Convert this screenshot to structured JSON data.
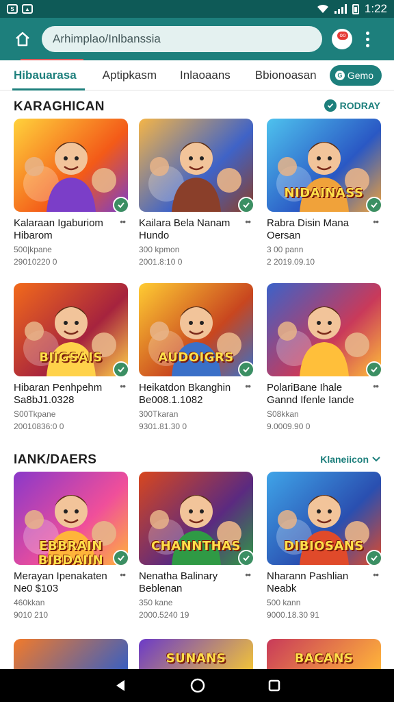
{
  "status_bar": {
    "time": "1:22"
  },
  "app_bar": {
    "url": "Arhimplao/Inlbanssia"
  },
  "tabs": [
    {
      "label": "Hibauarasa",
      "active": true
    },
    {
      "label": "Aptipkasm",
      "active": false
    },
    {
      "label": "Inlaoaans",
      "active": false
    },
    {
      "label": "Bbionoasan",
      "active": false
    }
  ],
  "games_chip": {
    "label": "Gemo"
  },
  "sections": [
    {
      "title": "KARAGHICAN",
      "action": "RODRAY",
      "cards": [
        {
          "title": "Kalaraan Igaburiom Hibarom",
          "meta1": "500|kpane",
          "meta2": "29010220 0",
          "thumb_text": "",
          "palette": [
            "#ffd23c",
            "#f35a18",
            "#7b3ec8"
          ]
        },
        {
          "title": "Kailara Bela Nanam Hundo",
          "meta1": "300 kpmon",
          "meta2": "2001.8:10 0",
          "thumb_text": "",
          "palette": [
            "#f5b547",
            "#3f63c7",
            "#8a3f2a"
          ]
        },
        {
          "title": "Rabra Disin Mana Oersan",
          "meta1": "3 00 pann",
          "meta2": "2 2019.09.10",
          "thumb_text": "NIDAINASS",
          "palette": [
            "#4ec2ee",
            "#2a58c4",
            "#f0a23a"
          ]
        },
        {
          "title": "Hibaran Penhpehm Sa8bJ1.0328",
          "meta1": "S00Tkpane",
          "meta2": "20010836:0 0",
          "thumb_text": "BIIGSAIS",
          "palette": [
            "#f26a1b",
            "#a6233e",
            "#ffd24a"
          ]
        },
        {
          "title": "Heikatdon Bkanghin Be008.1.1082",
          "meta1": "300Tkaran",
          "meta2": "9301.81.30 0",
          "thumb_text": "AUDOIGRS",
          "palette": [
            "#ffcc33",
            "#c8461f",
            "#3a70c8"
          ]
        },
        {
          "title": "PolariBane Ihale Gannd Ifenle Iande",
          "meta1": "S08kkan",
          "meta2": "9.0009.90 0",
          "thumb_text": "",
          "palette": [
            "#3b62c9",
            "#c93a5a",
            "#ffbf3a"
          ]
        }
      ]
    },
    {
      "title": "IANK/DAERS",
      "action": "Klaneiicon",
      "cards": [
        {
          "title": "Merayan Ipenakaten Ne0 $103",
          "meta1": "460kkan",
          "meta2": "9010 210",
          "thumb_text": "EBBRAIN BIBDAIIN",
          "palette": [
            "#8a38c9",
            "#f04f9a",
            "#ffb43a"
          ]
        },
        {
          "title": "Nenatha Balinary Beblenan",
          "meta1": "350 kane",
          "meta2": "2000.5240 19",
          "thumb_text": "CHANNTHAS",
          "palette": [
            "#d8471e",
            "#5b2a80",
            "#2f9a45"
          ]
        },
        {
          "title": "Nharann Pashlian Neabk",
          "meta1": "500 kann",
          "meta2": "9000.18.30 91",
          "thumb_text": "DIBIOSANS",
          "palette": [
            "#3fa4e8",
            "#2a4fb0",
            "#e04a2a"
          ]
        }
      ]
    }
  ],
  "peek_row": [
    {
      "thumb_text": "",
      "palette": [
        "#f27a2a",
        "#3a5fc0"
      ]
    },
    {
      "thumb_text": "SUNANS",
      "palette": [
        "#6b3ac8",
        "#f0c23a"
      ]
    },
    {
      "thumb_text": "BACANS",
      "palette": [
        "#c83a5a",
        "#ffb43a"
      ]
    }
  ]
}
